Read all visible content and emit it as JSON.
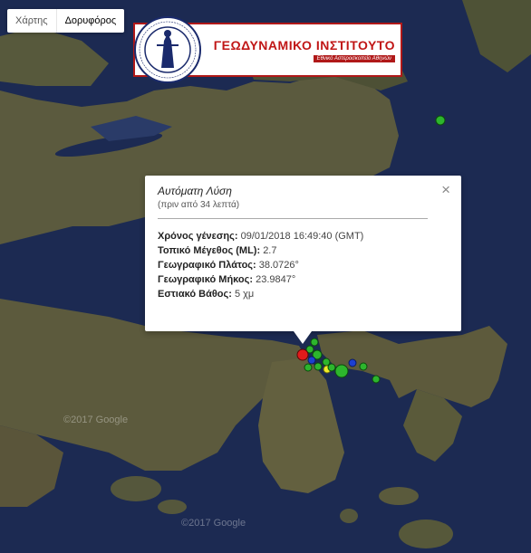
{
  "map_type": {
    "options": [
      "Χάρτης",
      "Δορυφόρος"
    ],
    "selected": "Δορυφόρος"
  },
  "banner": {
    "name": "ΓΕΩΔΥΝΑΜΙΚΟ ΙΝΣΤΙΤΟΥΤΟ",
    "subtitle": "Εθνικό Αστεροσκοπείο Αθηνών",
    "seal_text": "ΕΘΝΙΚΟΝ ΑΣΤΕΡΟΣΚΟΠΕΙΟΝ ΑΘΗΝΩΝ · NATIONAL OBSERVATORY OF ATHENS"
  },
  "info": {
    "title": "Αυτόματη Λύση",
    "ago": "(πριν από 34 λεπτά)",
    "rows": [
      {
        "label": "Χρόνος γένεσης:",
        "value": "09/01/2018  16:49:40 (GMT)"
      },
      {
        "label": "Τοπικό Μέγεθος (ML):",
        "value": "2.7"
      },
      {
        "label": "Γεωγραφικό Πλάτος:",
        "value": "38.0726°"
      },
      {
        "label": "Γεωγραφικό Μήκος:",
        "value": "23.9847°"
      },
      {
        "label": "Εστιακό Βάθος:",
        "value": "5 χμ"
      }
    ],
    "close_symbol": "×"
  },
  "credits": [
    "©2017 Google",
    "©2017 Google"
  ],
  "colors": {
    "sea": "#1c2a52",
    "land": "#5a5a3e",
    "marker_red": "#e21b1b",
    "marker_green": "#2db52d",
    "marker_blue": "#1c3fd1",
    "marker_yellow": "#f1ec2a",
    "banner_red": "#b01818"
  },
  "markers": [
    {
      "color": "red",
      "size": "large"
    },
    {
      "color": "green",
      "size": "large"
    },
    {
      "color": "blue",
      "size": "small"
    },
    {
      "color": "yellow",
      "size": "small"
    },
    {
      "color": "green",
      "size": "small"
    }
  ]
}
